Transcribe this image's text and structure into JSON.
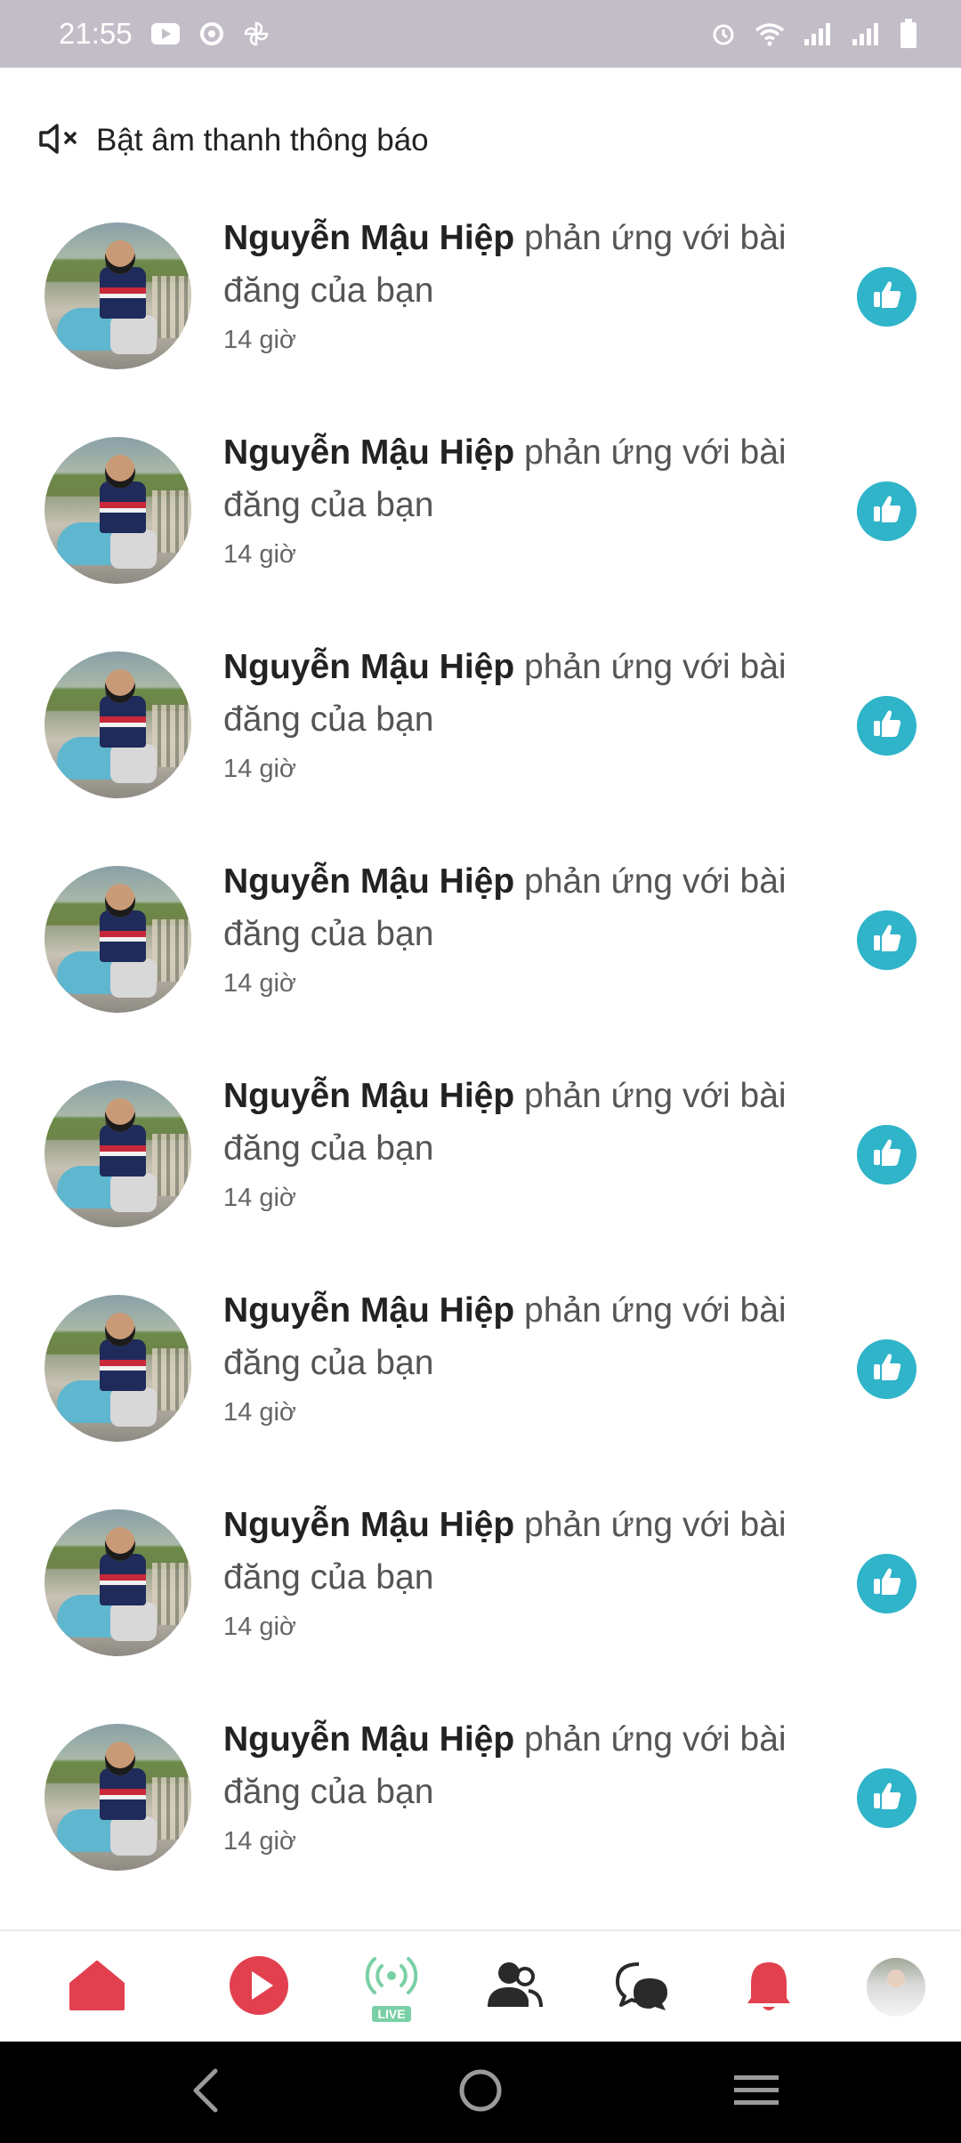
{
  "status_bar": {
    "time": "21:55",
    "icons_left": [
      "youtube-icon",
      "sync-icon",
      "pinwheel-icon"
    ],
    "icons_right": [
      "alarm-icon",
      "wifi-icon",
      "signal-icon",
      "signal-icon",
      "battery-icon"
    ]
  },
  "header": {
    "unmute_label": "Bật âm thanh thông báo",
    "unmute_icon": "speaker-muted-icon"
  },
  "notifications": [
    {
      "name": "Nguyễn Mậu Hiệp",
      "action": " phản ứng với bài đăng của bạn",
      "time": "14 giờ",
      "reaction": "like-icon"
    },
    {
      "name": "Nguyễn Mậu Hiệp",
      "action": " phản ứng với bài đăng của bạn",
      "time": "14 giờ",
      "reaction": "like-icon"
    },
    {
      "name": "Nguyễn Mậu Hiệp",
      "action": " phản ứng với bài đăng của bạn",
      "time": "14 giờ",
      "reaction": "like-icon"
    },
    {
      "name": "Nguyễn Mậu Hiệp",
      "action": " phản ứng với bài đăng của bạn",
      "time": "14 giờ",
      "reaction": "like-icon"
    },
    {
      "name": "Nguyễn Mậu Hiệp",
      "action": " phản ứng với bài đăng của bạn",
      "time": "14 giờ",
      "reaction": "like-icon"
    },
    {
      "name": "Nguyễn Mậu Hiệp",
      "action": " phản ứng với bài đăng của bạn",
      "time": "14 giờ",
      "reaction": "like-icon"
    },
    {
      "name": "Nguyễn Mậu Hiệp",
      "action": " phản ứng với bài đăng của bạn",
      "time": "14 giờ",
      "reaction": "like-icon"
    },
    {
      "name": "Nguyễn Mậu Hiệp",
      "action": " phản ứng với bài đăng của bạn",
      "time": "14 giờ",
      "reaction": "like-icon"
    }
  ],
  "bottom_nav": {
    "items": [
      "home-icon",
      "video-play-icon",
      "live-icon",
      "friends-icon",
      "chat-icon",
      "bell-icon",
      "profile-avatar"
    ],
    "live_label": "LIVE",
    "active_item": "bell-icon"
  },
  "colors": {
    "accent_red": "#e2404f",
    "like_blue": "#2fb4c9",
    "live_green": "#7ad0a6",
    "status_bar_bg": "#c3bdc8"
  },
  "android_nav": [
    "back-icon",
    "home-circle-icon",
    "menu-icon"
  ]
}
